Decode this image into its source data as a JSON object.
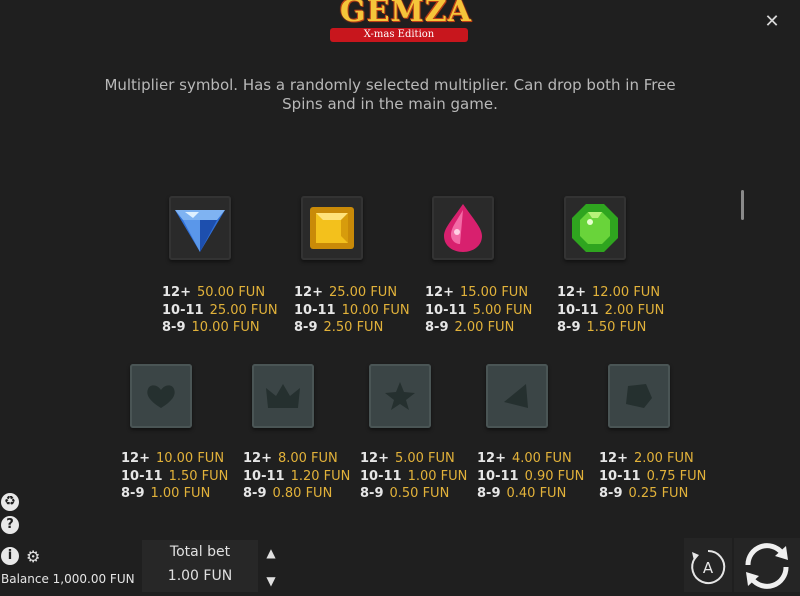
{
  "logo": {
    "title": "GEMZA",
    "subtitle": "X-mas Edition"
  },
  "close_label": "✕",
  "description": "Multiplier symbol. Has a randomly selected multiplier. Can drop both in Free Spins and in the main game.",
  "row1": [
    {
      "icon": "blue-diamond-icon",
      "pays": [
        [
          "12+",
          "50.00 FUN"
        ],
        [
          "10-11",
          "25.00 FUN"
        ],
        [
          "8-9",
          "10.00 FUN"
        ]
      ]
    },
    {
      "icon": "yellow-square-gem-icon",
      "pays": [
        [
          "12+",
          "25.00 FUN"
        ],
        [
          "10-11",
          "10.00 FUN"
        ],
        [
          "8-9",
          "2.50 FUN"
        ]
      ]
    },
    {
      "icon": "pink-drop-gem-icon",
      "pays": [
        [
          "12+",
          "15.00 FUN"
        ],
        [
          "10-11",
          "5.00 FUN"
        ],
        [
          "8-9",
          "2.00 FUN"
        ]
      ]
    },
    {
      "icon": "green-octagon-gem-icon",
      "pays": [
        [
          "12+",
          "12.00 FUN"
        ],
        [
          "10-11",
          "2.00 FUN"
        ],
        [
          "8-9",
          "1.50 FUN"
        ]
      ]
    }
  ],
  "row2": [
    {
      "icon": "stone-heart-icon",
      "pays": [
        [
          "12+",
          "10.00 FUN"
        ],
        [
          "10-11",
          "1.50 FUN"
        ],
        [
          "8-9",
          "1.00 FUN"
        ]
      ]
    },
    {
      "icon": "stone-crown-icon",
      "pays": [
        [
          "12+",
          "8.00 FUN"
        ],
        [
          "10-11",
          "1.20 FUN"
        ],
        [
          "8-9",
          "0.80 FUN"
        ]
      ]
    },
    {
      "icon": "stone-star-icon",
      "pays": [
        [
          "12+",
          "5.00 FUN"
        ],
        [
          "10-11",
          "1.00 FUN"
        ],
        [
          "8-9",
          "0.50 FUN"
        ]
      ]
    },
    {
      "icon": "stone-triangle-icon",
      "pays": [
        [
          "12+",
          "4.00 FUN"
        ],
        [
          "10-11",
          "0.90 FUN"
        ],
        [
          "8-9",
          "0.40 FUN"
        ]
      ]
    },
    {
      "icon": "stone-pentagon-icon",
      "pays": [
        [
          "12+",
          "2.00 FUN"
        ],
        [
          "10-11",
          "0.75 FUN"
        ],
        [
          "8-9",
          "0.25 FUN"
        ]
      ]
    }
  ],
  "footer": {
    "balance": "Balance 1,000.00 FUN",
    "total_bet_label": "Total bet",
    "total_bet_value": "1.00 FUN",
    "auto_label": "A"
  },
  "colors": {
    "background": "#1f1f1f",
    "pay_value": "#e2b23a",
    "ribbon": "#c8161d"
  }
}
